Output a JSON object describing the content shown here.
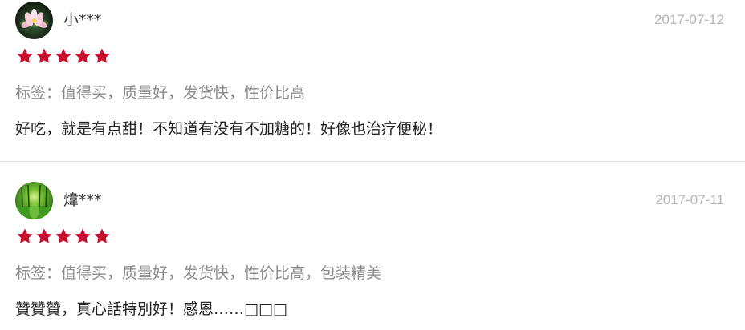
{
  "colors": {
    "star": "#c8102e",
    "username": "#333333",
    "date": "#b5b5b5",
    "tags": "#8a8a8a",
    "content": "#222222",
    "divider": "#e2e2e2"
  },
  "reviews": [
    {
      "avatar_icon": "lotus-flower-avatar",
      "username": "小***",
      "date": "2017-07-12",
      "rating": 5,
      "tags": "标签：值得买，质量好，发货快，性价比高",
      "content": "好吃，就是有点甜！不知道有没有不加糖的！好像也治疗便秘！"
    },
    {
      "avatar_icon": "green-forest-avatar",
      "username": "煒***",
      "date": "2017-07-11",
      "rating": 5,
      "tags": "标签：值得买，质量好，发货快，性价比高，包装精美",
      "content": "贊贊贊，真心話特別好！感恩……□□□"
    }
  ]
}
